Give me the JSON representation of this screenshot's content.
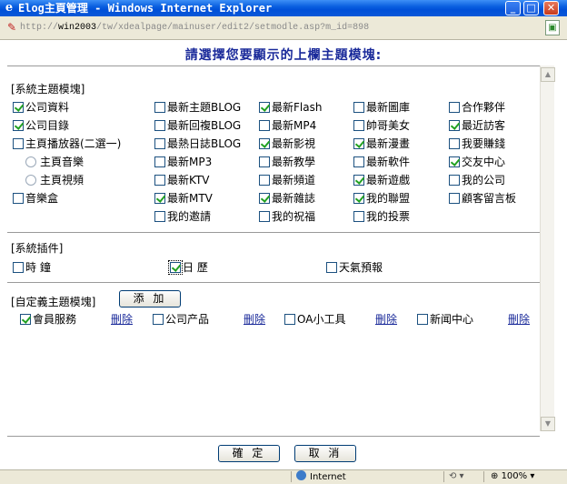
{
  "window": {
    "title": "Elog主頁管理 - Windows Internet Explorer",
    "url_prefix": "http://",
    "url_host": "win2003",
    "url_path": "/tw/xdealpage/mainuser/edit2/setmodle.asp?m_id=898"
  },
  "page": {
    "heading": "請選擇您要顯示的上欄主題模塊:"
  },
  "system_modules": {
    "section_label": "[系統主題模塊]",
    "items": [
      {
        "label": "公司資料",
        "checked": true
      },
      {
        "label": "公司目錄",
        "checked": true
      },
      {
        "label": "主頁播放器(二選一)",
        "checked": false
      },
      {
        "label": "主頁音樂",
        "checked": false,
        "radio": true
      },
      {
        "label": "主頁視頻",
        "checked": false,
        "radio": true
      },
      {
        "label": "音樂盒",
        "checked": false
      },
      {
        "label": "最新主題BLOG",
        "checked": false
      },
      {
        "label": "最新回複BLOG",
        "checked": false
      },
      {
        "label": "最熱日誌BLOG",
        "checked": false
      },
      {
        "label": "最新MP3",
        "checked": false
      },
      {
        "label": "最新KTV",
        "checked": false
      },
      {
        "label": "最新MTV",
        "checked": true
      },
      {
        "label": "我的邀請",
        "checked": false
      },
      {
        "label": "最新Flash",
        "checked": true
      },
      {
        "label": "最新MP4",
        "checked": false
      },
      {
        "label": "最新影視",
        "checked": true
      },
      {
        "label": "最新教學",
        "checked": false
      },
      {
        "label": "最新頻道",
        "checked": false
      },
      {
        "label": "最新雜誌",
        "checked": true
      },
      {
        "label": "我的祝福",
        "checked": false
      },
      {
        "label": "最新圖庫",
        "checked": false
      },
      {
        "label": "帥哥美女",
        "checked": false
      },
      {
        "label": "最新漫畫",
        "checked": true
      },
      {
        "label": "最新軟件",
        "checked": false
      },
      {
        "label": "最新遊戲",
        "checked": true
      },
      {
        "label": "我的聯盟",
        "checked": true
      },
      {
        "label": "我的投票",
        "checked": false
      },
      {
        "label": "合作夥伴",
        "checked": false
      },
      {
        "label": "最近訪客",
        "checked": true
      },
      {
        "label": "我要賺錢",
        "checked": false
      },
      {
        "label": "交友中心",
        "checked": true
      },
      {
        "label": "我的公司",
        "checked": false
      },
      {
        "label": "顧客留言板",
        "checked": false
      }
    ]
  },
  "plugins": {
    "section_label": "[系統插件]",
    "items": [
      {
        "label": "時 鐘",
        "checked": false
      },
      {
        "label": "日 歷",
        "checked": true
      },
      {
        "label": "天氣預報",
        "checked": false
      }
    ]
  },
  "custom_modules": {
    "section_label": "[自定義主題模塊]",
    "add_button": "添 加",
    "delete_label": "刪除",
    "items": [
      {
        "label": "會員服務",
        "checked": true
      },
      {
        "label": "公司产品",
        "checked": false
      },
      {
        "label": "OA小工具",
        "checked": false
      },
      {
        "label": "新闻中心",
        "checked": false
      }
    ]
  },
  "buttons": {
    "ok": "確 定",
    "cancel": "取 消"
  },
  "status": {
    "zone": "Internet",
    "zoom": "100%"
  },
  "colors": {
    "heading": "#1a2a9a",
    "link": "#1a2a9a",
    "check": "#21a121"
  }
}
